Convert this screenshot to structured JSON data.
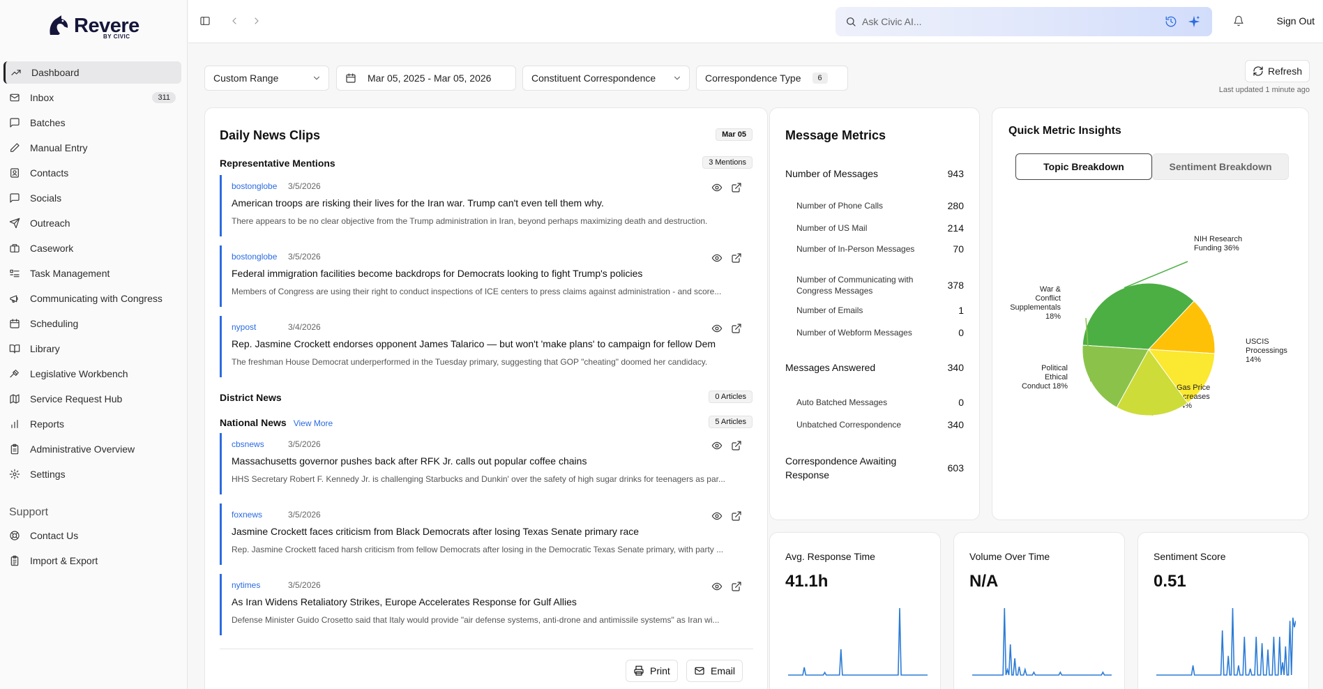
{
  "logo": {
    "name": "Revere",
    "sub": "BY CIVIC"
  },
  "sidebar": {
    "items": [
      {
        "label": "Dashboard",
        "icon": "trending-up-icon",
        "active": true
      },
      {
        "label": "Inbox",
        "icon": "mail-icon",
        "badge": "311"
      },
      {
        "label": "Batches",
        "icon": "message-square-icon"
      },
      {
        "label": "Manual Entry",
        "icon": "pencil-icon"
      },
      {
        "label": "Contacts",
        "icon": "contact-icon"
      },
      {
        "label": "Socials",
        "icon": "message-icon"
      },
      {
        "label": "Outreach",
        "icon": "send-icon"
      },
      {
        "label": "Casework",
        "icon": "briefcase-icon"
      },
      {
        "label": "Task Management",
        "icon": "list-todo-icon"
      },
      {
        "label": "Communicating with Congress",
        "icon": "megaphone-icon"
      },
      {
        "label": "Scheduling",
        "icon": "calendar-icon"
      },
      {
        "label": "Library",
        "icon": "book-open-icon"
      },
      {
        "label": "Legislative Workbench",
        "icon": "gavel-icon"
      },
      {
        "label": "Service Request Hub",
        "icon": "map-icon"
      },
      {
        "label": "Reports",
        "icon": "bar-chart-icon"
      },
      {
        "label": "Administrative Overview",
        "icon": "clipboard-icon"
      },
      {
        "label": "Settings",
        "icon": "gear-icon"
      }
    ],
    "support_title": "Support",
    "support_items": [
      {
        "label": "Contact Us",
        "icon": "lifebuoy-icon"
      },
      {
        "label": "Import & Export",
        "icon": "clipboard-list-icon"
      }
    ]
  },
  "topbar": {
    "search_placeholder": "Ask Civic AI...",
    "sign_out": "Sign Out"
  },
  "filters": {
    "range": "Custom Range",
    "dates": "Mar 05, 2025 - Mar 05, 2026",
    "source": "Constituent Correspondence",
    "type_label": "Correspondence Type",
    "type_count": "6",
    "refresh": "Refresh",
    "updated": "Last updated 1 minute ago"
  },
  "news": {
    "title": "Daily News Clips",
    "date": "Mar 05",
    "rep_title": "Representative Mentions",
    "rep_count": "3 Mentions",
    "rep_clips": [
      {
        "source": "bostonglobe",
        "date": "3/5/2026",
        "title": "American troops are risking their lives for the Iran war. Trump can't even tell them why.",
        "desc": "There appears to be no clear objective from the Trump administration in Iran, beyond perhaps maximizing death and destruction."
      },
      {
        "source": "bostonglobe",
        "date": "3/5/2026",
        "title": "Federal immigration facilities become backdrops for Democrats looking to fight Trump's policies",
        "desc": "Members of Congress are using their right to conduct inspections of ICE centers to press claims against administration - and score..."
      },
      {
        "source": "nypost",
        "date": "3/4/2026",
        "title": "Rep. Jasmine Crockett endorses opponent James Talarico — but won't 'make plans' to campaign for fellow Dem",
        "desc": "The freshman House Democrat underperformed in the Tuesday primary, suggesting that GOP \"cheating\" doomed her candidacy."
      }
    ],
    "district_title": "District News",
    "district_count": "0 Articles",
    "national_title": "National News",
    "view_more": "View More",
    "national_count": "5 Articles",
    "national_clips": [
      {
        "source": "cbsnews",
        "date": "3/5/2026",
        "title": "Massachusetts governor pushes back after RFK Jr. calls out popular coffee chains",
        "desc": "HHS Secretary Robert F. Kennedy Jr. is challenging Starbucks and Dunkin' over the safety of high sugar drinks for teenagers as par..."
      },
      {
        "source": "foxnews",
        "date": "3/5/2026",
        "title": "Jasmine Crockett faces criticism from Black Democrats after losing Texas Senate primary race",
        "desc": "Rep. Jasmine Crockett faced harsh criticism from fellow Democrats after losing in the Democratic Texas Senate primary, with party ..."
      },
      {
        "source": "nytimes",
        "date": "3/5/2026",
        "title": "As Iran Widens Retaliatory Strikes, Europe Accelerates Response for Gulf Allies",
        "desc": "Defense Minister Guido Crosetto said that Italy would provide \"air defense systems, anti-drone and antimissile systems\" as Iran wi..."
      }
    ],
    "print": "Print",
    "email": "Email"
  },
  "metrics": {
    "title": "Message Metrics",
    "rows": [
      {
        "label": "Number of Messages",
        "value": "943",
        "major": true
      },
      {
        "label": "Number of Phone Calls",
        "value": "280"
      },
      {
        "label": "Number of US Mail",
        "value": "214"
      },
      {
        "label": "Number of In-Person Messages",
        "value": "70"
      },
      {
        "label": "Number of Communicating with Congress Messages",
        "value": "378"
      },
      {
        "label": "Number of Emails",
        "value": "1"
      },
      {
        "label": "Number of Webform Messages",
        "value": "0"
      },
      {
        "label": "Messages Answered",
        "value": "340",
        "major": true
      },
      {
        "label": "Auto Batched Messages",
        "value": "0"
      },
      {
        "label": "Unbatched Correspondence",
        "value": "340"
      },
      {
        "label": "Correspondence Awaiting Response",
        "value": "603",
        "major": true
      }
    ]
  },
  "insights": {
    "title": "Quick Metric Insights",
    "tab_active": "Topic Breakdown",
    "tab_inactive": "Sentiment Breakdown"
  },
  "chart_data": [
    {
      "type": "pie",
      "slices": [
        {
          "label": "NIH Research Funding 36%",
          "value": 36,
          "color": "#4caf43"
        },
        {
          "label": "USCIS Processings 14%",
          "value": 14,
          "color": "#ffc107"
        },
        {
          "label": "Gas Price Increases 14%",
          "value": 14,
          "color": "#fbe830"
        },
        {
          "label": "Political Ethical Conduct 18%",
          "value": 18,
          "color": "#cddc39"
        },
        {
          "label": "War & Conflict Supplementals 18%",
          "value": 18,
          "color": "#8bc34a"
        }
      ]
    },
    {
      "type": "line",
      "title": "Avg. Response Time",
      "value": "41.1h",
      "values": [
        0,
        0,
        0,
        0,
        0,
        0,
        0,
        0,
        0,
        0,
        0,
        3,
        0,
        0,
        0,
        0,
        0,
        0,
        0,
        0,
        0,
        0,
        0,
        0,
        0,
        1,
        0,
        0,
        0,
        0,
        0,
        0,
        0,
        0,
        0,
        0,
        10,
        0,
        0,
        0,
        0,
        0,
        0,
        0,
        0,
        0,
        0,
        0,
        0,
        0,
        0,
        0,
        0,
        0,
        0,
        0,
        0,
        0,
        0,
        0,
        0,
        0,
        0,
        0,
        0,
        0,
        0,
        0,
        0,
        0,
        0,
        0,
        0,
        0,
        0,
        0,
        26,
        0,
        0,
        0,
        0,
        0,
        0,
        0,
        0,
        0,
        0,
        0,
        0,
        0,
        0,
        0,
        0,
        0,
        0,
        0
      ]
    },
    {
      "type": "line",
      "title": "Volume Over Time",
      "value": "N/A",
      "values": [
        0,
        0,
        0,
        0,
        0,
        0,
        0,
        0,
        0,
        0,
        0,
        0,
        0,
        0,
        0,
        0,
        0,
        0,
        0,
        0,
        0,
        0,
        24,
        0,
        2,
        0,
        11,
        0,
        0,
        6,
        0,
        0,
        3,
        0,
        0,
        0,
        2,
        0,
        0,
        0,
        0,
        0,
        1,
        0,
        0,
        0,
        0,
        0,
        0,
        0,
        0,
        0,
        0,
        0,
        0,
        0,
        0,
        0,
        0,
        0,
        1,
        0,
        0,
        0,
        0,
        0,
        0,
        0,
        0,
        0,
        0,
        0,
        0,
        0,
        0,
        0,
        0,
        0,
        0,
        0,
        0,
        0,
        0,
        0,
        0,
        0,
        0,
        0,
        0,
        1,
        0,
        0,
        0,
        0,
        0,
        0
      ]
    },
    {
      "type": "line",
      "title": "Sentiment Score",
      "value": "0.51",
      "values": [
        0,
        0,
        0,
        0,
        0,
        0,
        0,
        0,
        0,
        0,
        0,
        0,
        0,
        0,
        0,
        0,
        0,
        0,
        0,
        0,
        0,
        0,
        0,
        0,
        0,
        3,
        0,
        0,
        0,
        0,
        0,
        0,
        0,
        0,
        0,
        0,
        0,
        0,
        0,
        0,
        0,
        0,
        0,
        0,
        0,
        14,
        0,
        0,
        0,
        6,
        0,
        0,
        21,
        0,
        0,
        0,
        3,
        0,
        0,
        0,
        12,
        0,
        0,
        0,
        2,
        0,
        0,
        0,
        12,
        0,
        0,
        0,
        10,
        0,
        0,
        0,
        8,
        0,
        0,
        0,
        12,
        0,
        0,
        0,
        12,
        0,
        4,
        0,
        9,
        0,
        0,
        17,
        0,
        18,
        15,
        17
      ]
    }
  ]
}
